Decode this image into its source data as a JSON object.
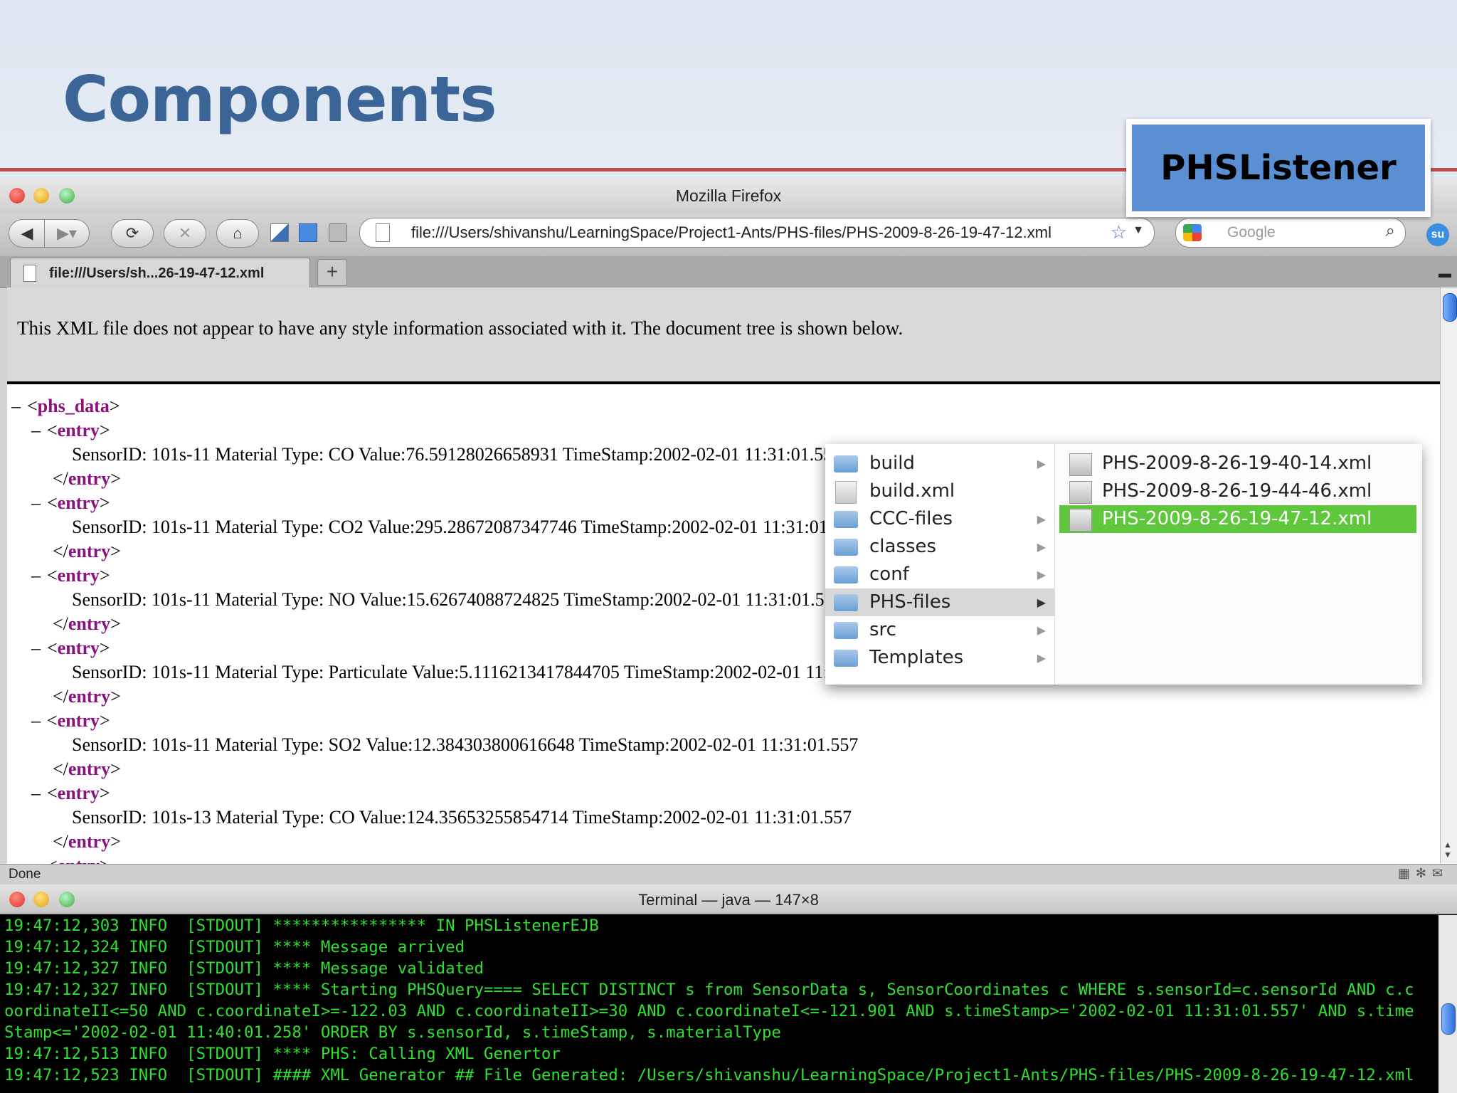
{
  "slide": {
    "title": "Components",
    "callout": "PHSListener",
    "accent_color": "#3a6596",
    "callout_color": "#5b8fd3",
    "rule_color": "#c0504d"
  },
  "firefox": {
    "window_title": "Mozilla Firefox",
    "url": "file:///Users/shivanshu/LearningSpace/Project1-Ants/PHS-files/PHS-2009-8-26-19-47-12.xml",
    "search_placeholder": "Google",
    "tab_label": "file:///Users/sh...26-19-47-12.xml",
    "new_tab": "+",
    "status": "Done",
    "xml_notice": "This XML file does not appear to have any style information associated with it. The document tree is shown below.",
    "toolbar_icons": [
      "back-icon",
      "forward-icon",
      "reload-icon",
      "stop-icon",
      "home-icon"
    ]
  },
  "xml": {
    "root_tag": "phs_data",
    "entry_tag": "entry",
    "minus": "–",
    "entries": [
      "SensorID: 101s-11 Material Type: CO Value:76.59128026658931 TimeStamp:2002-02-01 11:31:01.557",
      "SensorID: 101s-11 Material Type: CO2 Value:295.28672087347746 TimeStamp:2002-02-01 11:31:01.557",
      "SensorID: 101s-11 Material Type: NO Value:15.62674088724825 TimeStamp:2002-02-01 11:31:01.557",
      "SensorID: 101s-11 Material Type: Particulate Value:5.1116213417844705 TimeStamp:2002-02-01 11:31:01.557",
      "SensorID: 101s-11 Material Type: SO2 Value:12.384303800616648 TimeStamp:2002-02-01 11:31:01.557",
      "SensorID: 101s-13 Material Type: CO Value:124.35653255854714 TimeStamp:2002-02-01 11:31:01.557"
    ]
  },
  "finder_menu": {
    "items": [
      {
        "label": "build",
        "kind": "folder"
      },
      {
        "label": "build.xml",
        "kind": "file"
      },
      {
        "label": "CCC-files",
        "kind": "folder"
      },
      {
        "label": "classes",
        "kind": "folder"
      },
      {
        "label": "conf",
        "kind": "folder"
      },
      {
        "label": "PHS-files",
        "kind": "folder"
      },
      {
        "label": "src",
        "kind": "folder"
      },
      {
        "label": "Templates",
        "kind": "folder"
      }
    ],
    "highlighted": "PHS-files",
    "submenu": [
      "PHS-2009-8-26-19-40-14.xml",
      "PHS-2009-8-26-19-44-46.xml",
      "PHS-2009-8-26-19-47-12.xml"
    ],
    "selected_file": "PHS-2009-8-26-19-47-12.xml",
    "selection_color": "#5ec73c"
  },
  "terminal": {
    "title": "Terminal — java — 147×8",
    "text_color": "#30e030",
    "lines": [
      "19:47:12,303 INFO  [STDOUT] **************** IN PHSListenerEJB",
      "19:47:12,324 INFO  [STDOUT] **** Message arrived",
      "19:47:12,327 INFO  [STDOUT] **** Message validated",
      "19:47:12,327 INFO  [STDOUT] **** Starting PHSQuery==== SELECT DISTINCT s from SensorData s, SensorCoordinates c WHERE s.sensorId=c.sensorId AND c.c",
      "oordinateII<=50 AND c.coordinateI>=-122.03 AND c.coordinateII>=30 AND c.coordinateI<=-121.901 AND s.timeStamp>='2002-02-01 11:31:01.557' AND s.time",
      "Stamp<='2002-02-01 11:40:01.258' ORDER BY s.sensorId, s.timeStamp, s.materialType",
      "19:47:12,513 INFO  [STDOUT] **** PHS: Calling XML Genertor",
      "19:47:12,523 INFO  [STDOUT] #### XML Generator ## File Generated: /Users/shivanshu/LearningSpace/Project1-Ants/PHS-files/PHS-2009-8-26-19-47-12.xml"
    ]
  }
}
